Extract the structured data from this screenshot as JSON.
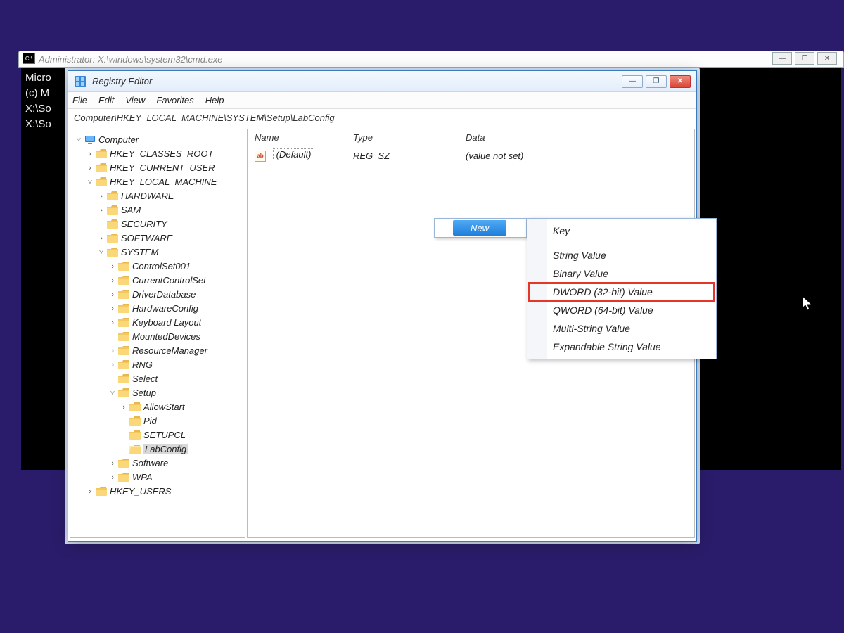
{
  "cmd": {
    "title": "Administrator: X:\\windows\\system32\\cmd.exe",
    "lines": [
      "Micro",
      "(c) M",
      "",
      "X:\\So",
      "",
      "X:\\So"
    ],
    "buttons": {
      "min": "—",
      "max": "❐",
      "close": "✕"
    }
  },
  "regedit": {
    "title": "Registry Editor",
    "menu": [
      "File",
      "Edit",
      "View",
      "Favorites",
      "Help"
    ],
    "address": "Computer\\HKEY_LOCAL_MACHINE\\SYSTEM\\Setup\\LabConfig",
    "buttons": {
      "min": "—",
      "max": "❐",
      "close": "✕"
    },
    "tree": [
      {
        "lvl": 0,
        "exp": "v",
        "ico": "computer",
        "label": "Computer"
      },
      {
        "lvl": 1,
        "exp": ">",
        "ico": "folder",
        "label": "HKEY_CLASSES_ROOT"
      },
      {
        "lvl": 1,
        "exp": ">",
        "ico": "folder",
        "label": "HKEY_CURRENT_USER"
      },
      {
        "lvl": 1,
        "exp": "v",
        "ico": "folder",
        "label": "HKEY_LOCAL_MACHINE"
      },
      {
        "lvl": 2,
        "exp": ">",
        "ico": "folder",
        "label": "HARDWARE"
      },
      {
        "lvl": 2,
        "exp": ">",
        "ico": "folder",
        "label": "SAM"
      },
      {
        "lvl": 2,
        "exp": " ",
        "ico": "folder",
        "label": "SECURITY"
      },
      {
        "lvl": 2,
        "exp": ">",
        "ico": "folder",
        "label": "SOFTWARE"
      },
      {
        "lvl": 2,
        "exp": "v",
        "ico": "folder",
        "label": "SYSTEM"
      },
      {
        "lvl": 3,
        "exp": ">",
        "ico": "folder",
        "label": "ControlSet001"
      },
      {
        "lvl": 3,
        "exp": ">",
        "ico": "folder",
        "label": "CurrentControlSet"
      },
      {
        "lvl": 3,
        "exp": ">",
        "ico": "folder",
        "label": "DriverDatabase"
      },
      {
        "lvl": 3,
        "exp": ">",
        "ico": "folder",
        "label": "HardwareConfig"
      },
      {
        "lvl": 3,
        "exp": ">",
        "ico": "folder",
        "label": "Keyboard Layout"
      },
      {
        "lvl": 3,
        "exp": " ",
        "ico": "folder",
        "label": "MountedDevices"
      },
      {
        "lvl": 3,
        "exp": ">",
        "ico": "folder",
        "label": "ResourceManager"
      },
      {
        "lvl": 3,
        "exp": ">",
        "ico": "folder",
        "label": "RNG"
      },
      {
        "lvl": 3,
        "exp": " ",
        "ico": "folder",
        "label": "Select"
      },
      {
        "lvl": 3,
        "exp": "v",
        "ico": "folder",
        "label": "Setup"
      },
      {
        "lvl": 4,
        "exp": ">",
        "ico": "folder",
        "label": "AllowStart"
      },
      {
        "lvl": 4,
        "exp": " ",
        "ico": "folder",
        "label": "Pid"
      },
      {
        "lvl": 4,
        "exp": " ",
        "ico": "folder",
        "label": "SETUPCL"
      },
      {
        "lvl": 4,
        "exp": " ",
        "ico": "folder-open",
        "label": "LabConfig",
        "selected": true
      },
      {
        "lvl": 3,
        "exp": ">",
        "ico": "folder",
        "label": "Software"
      },
      {
        "lvl": 3,
        "exp": ">",
        "ico": "folder",
        "label": "WPA"
      },
      {
        "lvl": 1,
        "exp": ">",
        "ico": "folder",
        "label": "HKEY_USERS"
      }
    ],
    "list": {
      "columns": {
        "name": "Name",
        "type": "Type",
        "data": "Data"
      },
      "rows": [
        {
          "icon": "ab",
          "name": "(Default)",
          "type": "REG_SZ",
          "data": "(value not set)"
        }
      ]
    }
  },
  "context": {
    "parent": {
      "label": "New"
    },
    "items": [
      {
        "label": "Key",
        "sep_after": true
      },
      {
        "label": "String Value"
      },
      {
        "label": "Binary Value"
      },
      {
        "label": "DWORD (32-bit) Value",
        "highlight": true
      },
      {
        "label": "QWORD (64-bit) Value"
      },
      {
        "label": "Multi-String Value"
      },
      {
        "label": "Expandable String Value"
      }
    ]
  }
}
